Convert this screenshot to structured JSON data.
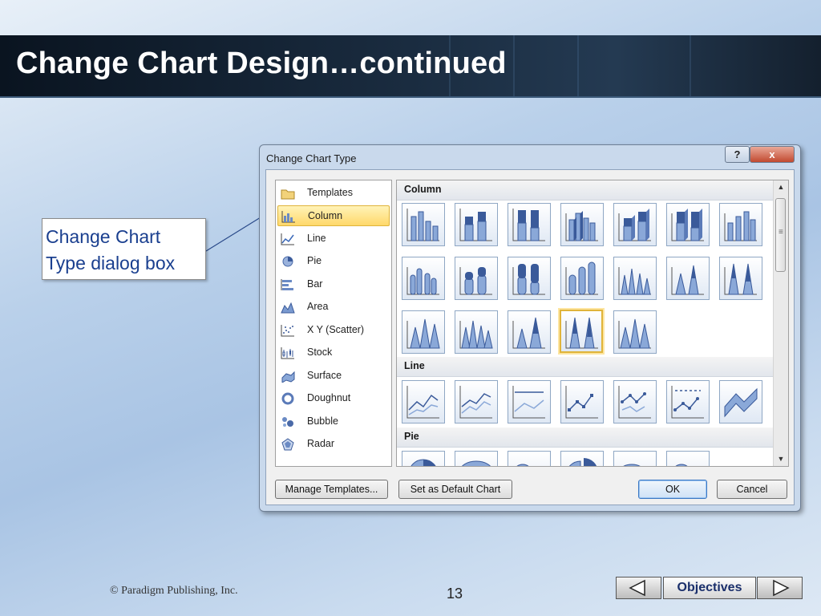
{
  "slide": {
    "title": "Change Chart Design…continued",
    "callout_line1": "Change Chart",
    "callout_line2": "Type dialog box",
    "footer": "© Paradigm Publishing, Inc.",
    "page_number": "13",
    "nav_label": "Objectives"
  },
  "dialog": {
    "title": "Change Chart Type",
    "help_label": "?",
    "close_label": "x",
    "chart_types": [
      {
        "label": "Templates",
        "icon": "folder-icon"
      },
      {
        "label": "Column",
        "icon": "column-chart-icon",
        "selected": true
      },
      {
        "label": "Line",
        "icon": "line-chart-icon"
      },
      {
        "label": "Pie",
        "icon": "pie-chart-icon"
      },
      {
        "label": "Bar",
        "icon": "bar-chart-icon"
      },
      {
        "label": "Area",
        "icon": "area-chart-icon"
      },
      {
        "label": "X Y (Scatter)",
        "icon": "scatter-chart-icon"
      },
      {
        "label": "Stock",
        "icon": "stock-chart-icon"
      },
      {
        "label": "Surface",
        "icon": "surface-chart-icon"
      },
      {
        "label": "Doughnut",
        "icon": "doughnut-chart-icon"
      },
      {
        "label": "Bubble",
        "icon": "bubble-chart-icon"
      },
      {
        "label": "Radar",
        "icon": "radar-chart-icon"
      }
    ],
    "sections": {
      "column": "Column",
      "line": "Line",
      "pie": "Pie"
    },
    "buttons": {
      "manage_templates": "Manage Templates...",
      "set_default": "Set as Default Chart",
      "ok": "OK",
      "cancel": "Cancel"
    }
  },
  "colors": {
    "accent_blue": "#1a3f8f",
    "selection_gold": "#ffd86a",
    "chart_blue": "#5a7fb8"
  }
}
